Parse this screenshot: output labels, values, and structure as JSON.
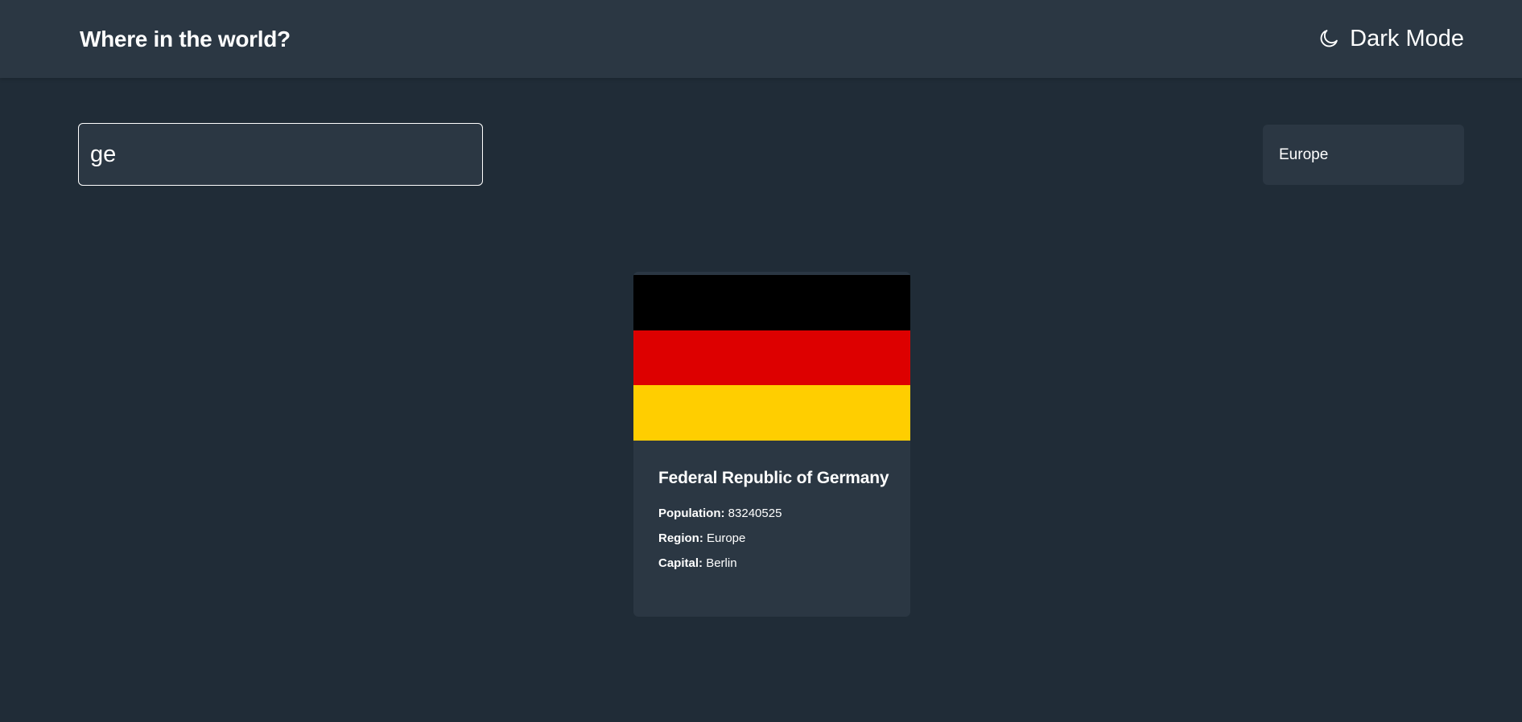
{
  "header": {
    "title": "Where in the world?",
    "theme_toggle": {
      "icon": "moon-icon",
      "label": "Dark Mode"
    }
  },
  "search": {
    "value": "ge",
    "placeholder": ""
  },
  "filter": {
    "selected": "Europe"
  },
  "colors": {
    "background": "#202c37",
    "element": "#2b3743",
    "text": "#ffffff"
  },
  "countries": [
    {
      "name": "Federal Republic of Germany",
      "flag": {
        "bands": [
          "#000000",
          "#dd0000",
          "#ffce00"
        ]
      },
      "population_label": "Population:",
      "population": "83240525",
      "region_label": "Region:",
      "region": "Europe",
      "capital_label": "Capital:",
      "capital": "Berlin"
    }
  ]
}
